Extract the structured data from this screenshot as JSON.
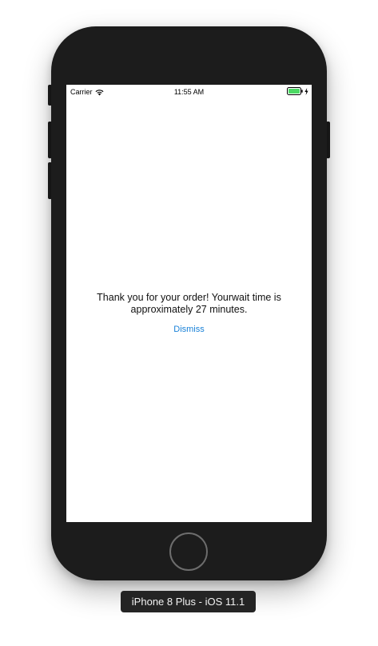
{
  "status_bar": {
    "carrier": "Carrier",
    "time": "11:55 AM"
  },
  "screen": {
    "message": "Thank you for your order! Yourwait time is approximately 27 minutes.",
    "dismiss_label": "Dismiss"
  },
  "device": {
    "label": "iPhone 8 Plus - iOS 11.1"
  },
  "icons": {
    "wifi": "wifi-icon",
    "battery": "battery-icon",
    "charging": "charging-bolt-icon"
  },
  "colors": {
    "device_body": "#1c1c1c",
    "link": "#1a82d8",
    "battery_fill": "#4cd964"
  }
}
